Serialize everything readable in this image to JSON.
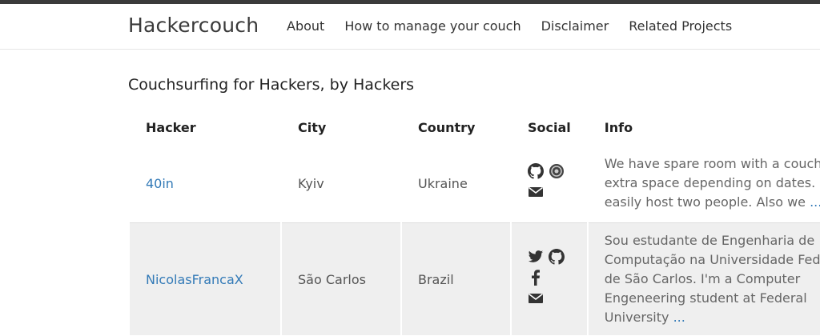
{
  "header": {
    "brand": "Hackercouch",
    "nav": [
      {
        "label": "About"
      },
      {
        "label": "How to manage your couch"
      },
      {
        "label": "Disclaimer"
      },
      {
        "label": "Related Projects"
      }
    ]
  },
  "main": {
    "title": "Couchsurfing for Hackers, by Hackers",
    "table": {
      "headers": [
        "Hacker",
        "City",
        "Country",
        "Social",
        "Info"
      ],
      "rows": [
        {
          "hacker": "40in",
          "city": "Kyiv",
          "country": "Ukraine",
          "social": [
            "github-icon",
            "gitlab-icon",
            "email-icon"
          ],
          "info": "We have spare room with a couch a extra space depending on dates. Ca easily host two people. Also we",
          "more": "..."
        },
        {
          "hacker": "NicolasFrancaX",
          "city": "São Carlos",
          "country": "Brazil",
          "social": [
            "twitter-icon",
            "github-icon",
            "facebook-icon",
            "email-icon"
          ],
          "info": "Sou estudante de Engenharia de Computação na Universidade Feder de São Carlos. I'm a Computer Engeneering student at Federal University",
          "more": "..."
        }
      ]
    }
  },
  "colors": {
    "topbar": "#3a3a3a",
    "link": "#337ab7",
    "row_alt": "#efefef"
  }
}
